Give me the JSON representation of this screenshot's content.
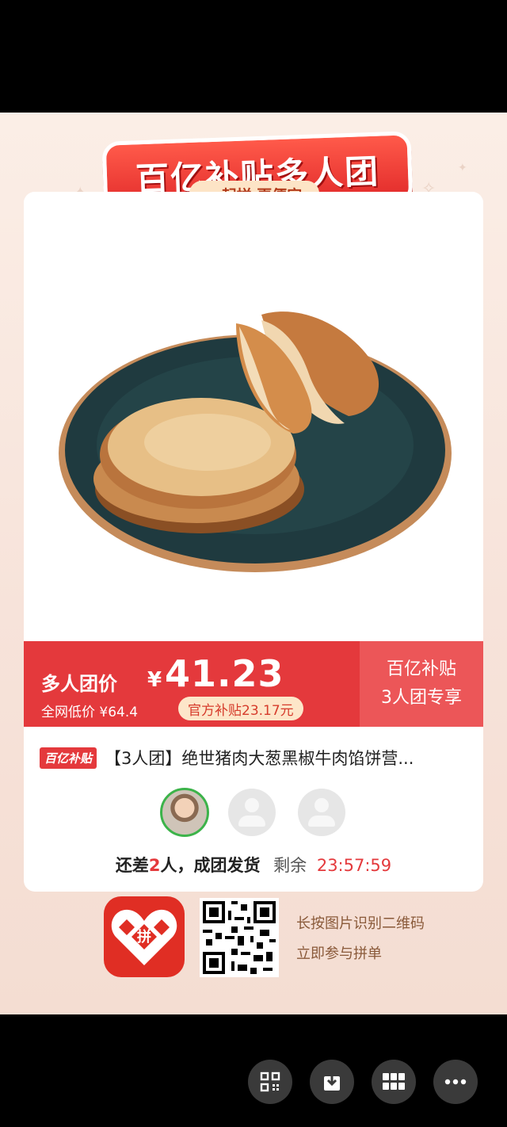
{
  "banner": {
    "title": "百亿补贴多人团",
    "slogan": "一起拼 更便宜"
  },
  "price_bar": {
    "group_label": "多人团价",
    "currency": "¥",
    "price": "41.23",
    "market_price": "全网低价 ¥64.4",
    "subsidy": "官方补贴23.17元",
    "right_line1": "百亿补贴",
    "right_line2": "3人团专享"
  },
  "product": {
    "badge": "百亿补贴",
    "title": "【3人团】绝世猪肉大葱黑椒牛肉馅饼营..."
  },
  "group_status": {
    "prefix": "还差",
    "missing": "2",
    "suffix": "人，成团发货",
    "remaining_label": "剩余",
    "timer": "23:57:59"
  },
  "footer": {
    "app_logo_text": "拼",
    "qr_hint_line1": "长按图片识别二维码",
    "qr_hint_line2": "立即参与拼单"
  },
  "colors": {
    "accent": "#e4393c",
    "poster_bg": "#fbeee6",
    "app_red": "#e02e24"
  },
  "toolbar_icons": [
    "qr-scan-icon",
    "download-icon",
    "grid-icon",
    "more-icon"
  ]
}
